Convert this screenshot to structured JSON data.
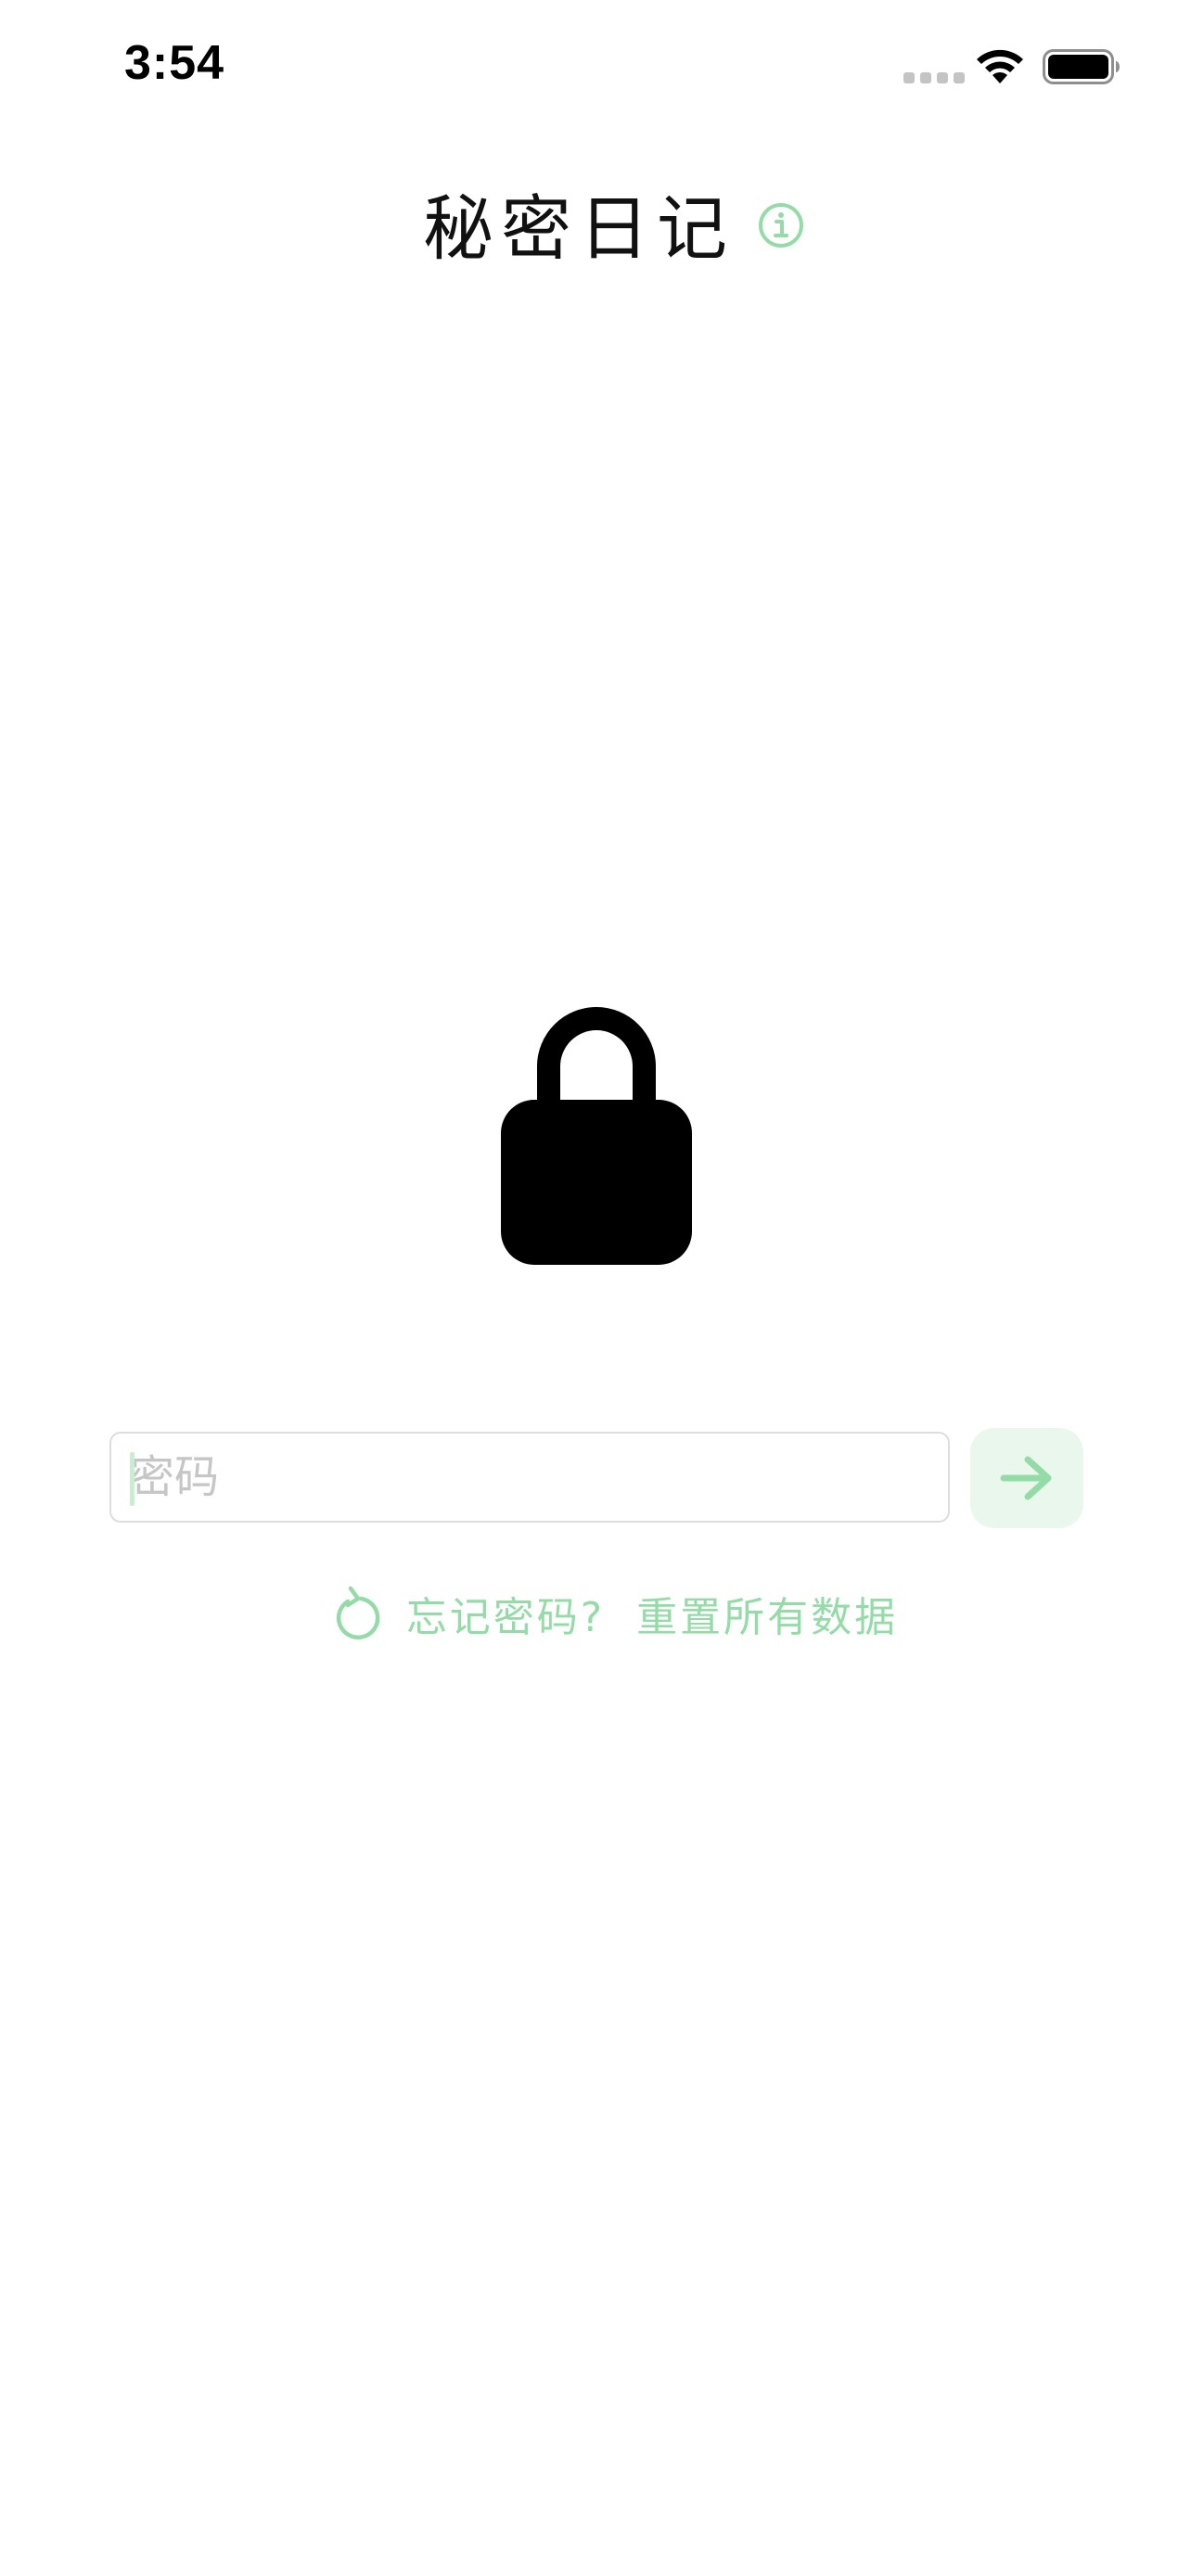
{
  "status_bar": {
    "time": "3:54",
    "icons": [
      "cellular-signal-icon",
      "wifi-icon",
      "battery-icon"
    ]
  },
  "header": {
    "title": "秘密日记",
    "info_icon": "info-icon"
  },
  "lock": {
    "icon": "lock-icon",
    "color": "#000000"
  },
  "login": {
    "password_placeholder": "密码",
    "password_value": "",
    "submit_icon": "arrow-right-icon"
  },
  "reset": {
    "icon": "reset-icon",
    "forgot_label": "忘记密码?",
    "reset_label": "重置所有数据"
  },
  "colors": {
    "accent": "#95dba8",
    "accent_light": "#e9f7ec",
    "field_border": "#dddddd",
    "placeholder": "#c6c6c6"
  }
}
